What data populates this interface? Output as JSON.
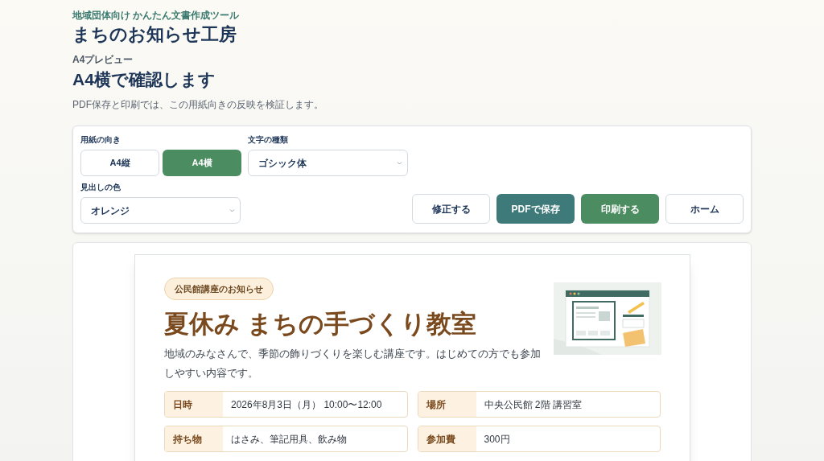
{
  "header": {
    "tagline": "地域団体向け かんたん文書作成ツール",
    "app_title": "まちのお知らせ工房",
    "section_label": "A4プレビュー",
    "heading": "A4横で確認します",
    "description": "PDF保存と印刷では、この用紙向きの反映を検証します。"
  },
  "controls": {
    "orientation": {
      "label": "用紙の向き",
      "options": [
        {
          "label": "A4縦",
          "selected": false
        },
        {
          "label": "A4横",
          "selected": true
        }
      ]
    },
    "font": {
      "label": "文字の種類",
      "value": "ゴシック体"
    },
    "heading_color": {
      "label": "見出しの色",
      "value": "オレンジ"
    },
    "actions": [
      {
        "label": "修正する",
        "kind": "outline"
      },
      {
        "label": "PDFで保存",
        "kind": "teal"
      },
      {
        "label": "印刷する",
        "kind": "green"
      },
      {
        "label": "ホーム",
        "kind": "outline"
      }
    ]
  },
  "document": {
    "badge": "公民館講座のお知らせ",
    "title": "夏休み まちの手づくり教室",
    "lead": "地域のみなさんで、季節の飾りづくりを楽しむ講座です。はじめての方でも参加しやすい内容です。",
    "details": [
      {
        "label": "日時",
        "value": "2026年8月3日（月） 10:00〜12:00"
      },
      {
        "label": "場所",
        "value": "中央公民館 2階 講習室"
      },
      {
        "label": "持ち物",
        "value": "はさみ、筆記用具、飲み物"
      },
      {
        "label": "参加費",
        "value": "300円"
      }
    ]
  }
}
